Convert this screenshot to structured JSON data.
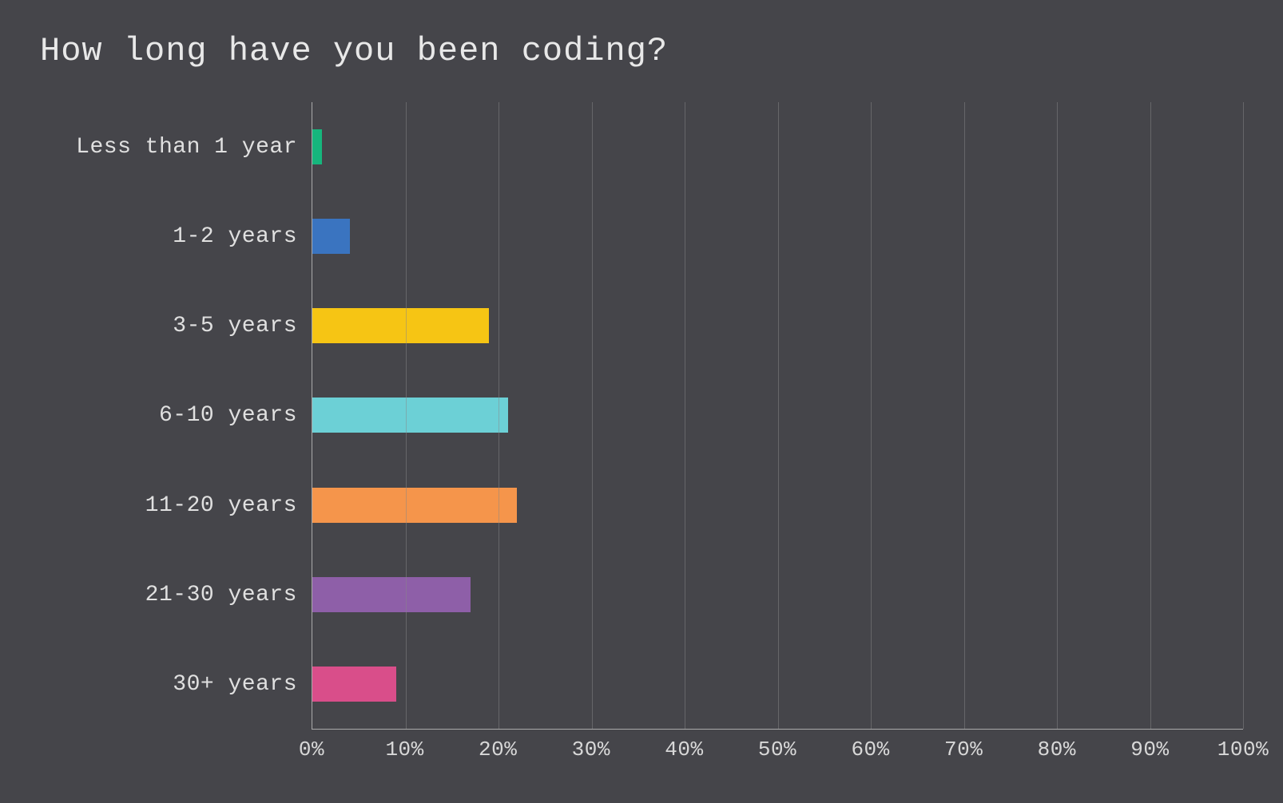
{
  "chart_data": {
    "type": "bar",
    "title": "How long have you been coding?",
    "categories": [
      "Less than 1 year",
      "1-2 years",
      "3-5 years",
      "6-10 years",
      "11-20 years",
      "21-30 years",
      "30+ years"
    ],
    "values": [
      1,
      4,
      19,
      21,
      22,
      17,
      9
    ],
    "colors": [
      "#16b67d",
      "#3a74c0",
      "#f6c514",
      "#6cd0d6",
      "#f5954b",
      "#8e5fa8",
      "#d94e8a"
    ],
    "xlabel": "",
    "ylabel": "",
    "xlim": [
      0,
      100
    ],
    "x_ticks": [
      0,
      10,
      20,
      30,
      40,
      50,
      60,
      70,
      80,
      90,
      100
    ],
    "x_tick_labels": [
      "0%",
      "10%",
      "20%",
      "30%",
      "40%",
      "50%",
      "60%",
      "70%",
      "80%",
      "90%",
      "100%"
    ]
  }
}
